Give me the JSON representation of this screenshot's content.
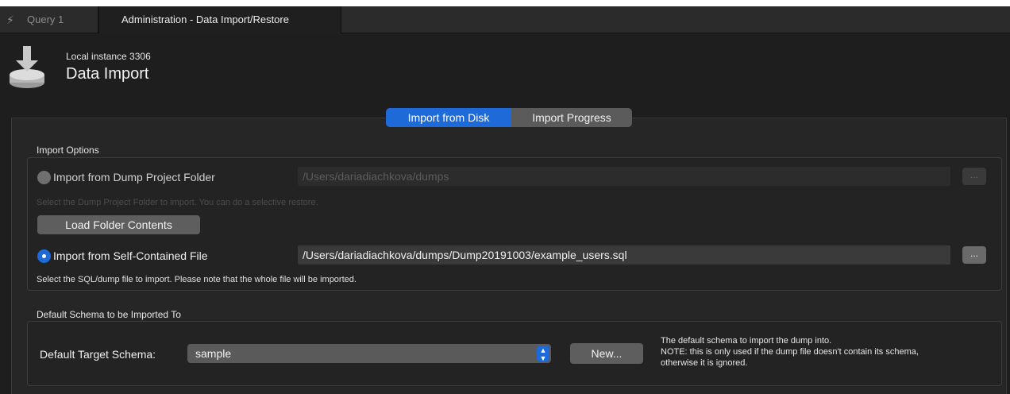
{
  "tabs": {
    "query": "Query 1",
    "admin": "Administration - Data Import/Restore"
  },
  "header": {
    "instance": "Local instance 3306",
    "title": "Data Import"
  },
  "segments": {
    "disk": "Import from Disk",
    "progress": "Import Progress"
  },
  "import_options": {
    "label": "Import Options",
    "dump_folder": {
      "label": "Import from Dump Project Folder",
      "path": "/Users/dariadiachkova/dumps",
      "hint": "Select the Dump Project Folder to import. You can do a selective restore.",
      "browse": "..."
    },
    "load_button": "Load Folder Contents",
    "self_contained": {
      "label": "Import from Self-Contained File",
      "path": "/Users/dariadiachkova/dumps/Dump20191003/example_users.sql",
      "hint": "Select the SQL/dump file to import. Please note that the whole file will be imported.",
      "browse": "..."
    }
  },
  "default_schema": {
    "label": "Default Schema to be Imported To",
    "target_label": "Default Target Schema:",
    "selected": "sample",
    "new_button": "New...",
    "note_line1": "The default schema to import the dump into.",
    "note_line2": "NOTE: this is only used if the dump file doesn't contain its schema,",
    "note_line3": "otherwise it is ignored."
  },
  "colors": {
    "accent": "#1e6ad8",
    "background": "#1e1e1e"
  },
  "icons": {
    "query_tab": "bolt-icon",
    "header": "data-import-icon",
    "select": "chevron-updown-icon"
  }
}
